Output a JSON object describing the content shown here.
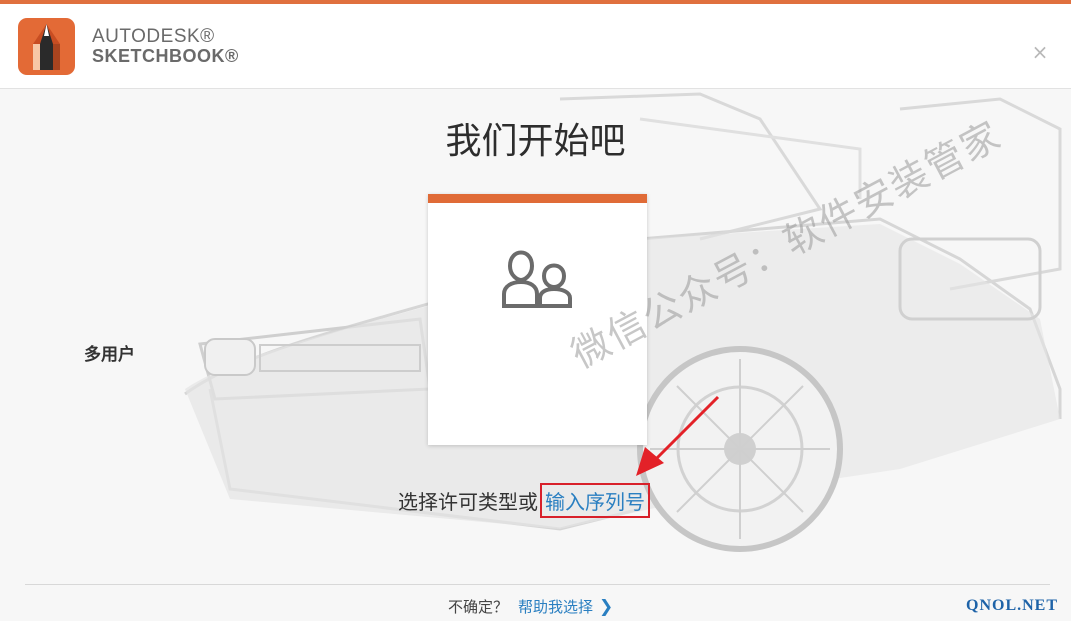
{
  "header": {
    "brand_line1": "AUTODESK®",
    "brand_line2": "SKETCHBOOK®",
    "close_symbol": "×"
  },
  "main": {
    "title": "我们开始吧",
    "license_card": {
      "label": "多用户",
      "icon": "multi-user-icon",
      "accent_color": "#e06b37"
    },
    "license_prompt": "选择许可类型或",
    "serial_link": "输入序列号"
  },
  "footer": {
    "unsure_text": "不确定？",
    "help_link": "帮助我选择",
    "chevron": "❯"
  },
  "watermark": {
    "text": "微信公众号：软件安装管家",
    "site": "QNOL.NET"
  },
  "colors": {
    "accent": "#e06b37",
    "link": "#2a7fc1",
    "highlight_box": "#d8202a"
  }
}
